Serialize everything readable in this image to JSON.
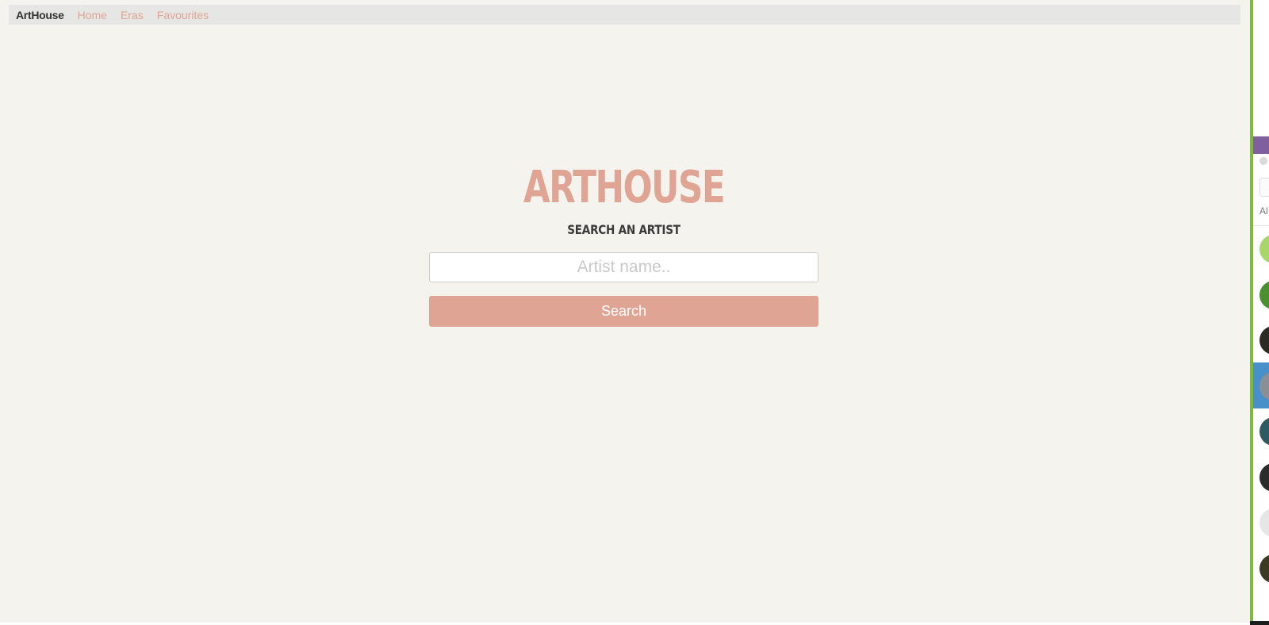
{
  "nav": {
    "brand": "ArtHouse",
    "links": [
      "Home",
      "Eras",
      "Favourites"
    ]
  },
  "hero": {
    "title": "ARTHOUSE",
    "subtitle": "SEARCH AN ARTIST"
  },
  "search": {
    "placeholder": "Artist name..",
    "button_label": "Search"
  },
  "edge_window": {
    "partial_text": "Al",
    "accent_color": "#7fb83f",
    "header_color": "#7f5f9e",
    "selected_color": "#4a90c8",
    "avatar_colors": [
      "#a7d66a",
      "#4c8f2e",
      "#2b2a24",
      "#8a8f96",
      "#2e5a63",
      "#2a2b2a",
      "#e6e6e6",
      "#3b3a22"
    ]
  },
  "theme": {
    "accent": "#dfa494",
    "page_background": "#f4f3ee",
    "navbar_background": "#e6e6e4",
    "text_dark": "#333333"
  }
}
